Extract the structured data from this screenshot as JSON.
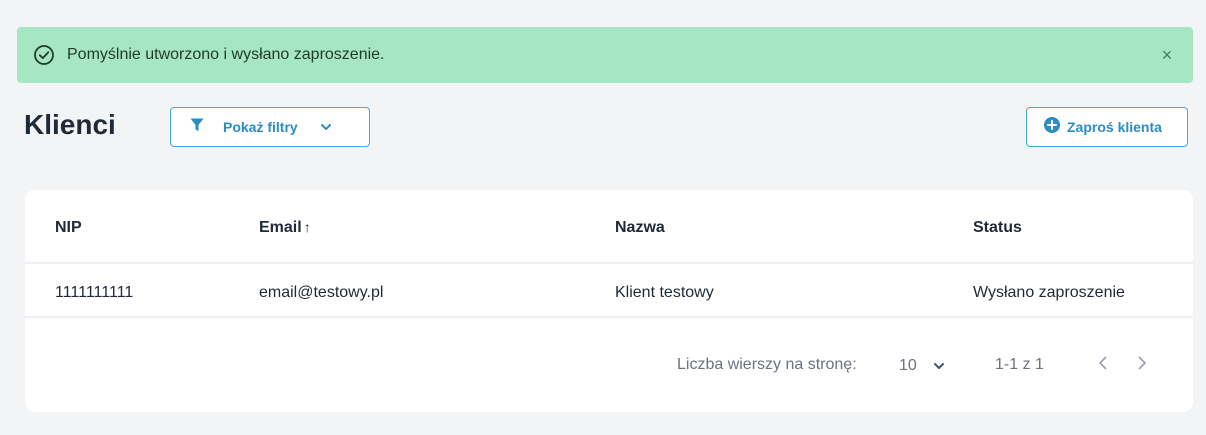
{
  "alert": {
    "message": "Pomyślnie utworzono i wysłano zaproszenie.",
    "close_symbol": "×",
    "icon": "check-circle-icon",
    "background": "#a7e6c3"
  },
  "header": {
    "title": "Klienci",
    "filter_button": {
      "label": "Pokaż filtry",
      "icon": "filter-icon",
      "chevron": "chevron-down-icon"
    },
    "invite_button": {
      "label": "Zaproś klienta",
      "icon": "plus-circle-icon"
    }
  },
  "table": {
    "columns": [
      {
        "label": "NIP"
      },
      {
        "label": "Email",
        "sort": "↑"
      },
      {
        "label": "Nazwa"
      },
      {
        "label": "Status"
      }
    ],
    "rows": [
      {
        "nip": "1111111111",
        "email": "email@testowy.pl",
        "nazwa": "Klient testowy",
        "status": "Wysłano zaproszenie"
      }
    ]
  },
  "pagination": {
    "rows_per_page_label": "Liczba wierszy na stronę:",
    "rows_per_page_value": "10",
    "range": "1-1 z 1"
  },
  "colors": {
    "accent": "#2a8dc4",
    "border": "#4aa8d8"
  }
}
